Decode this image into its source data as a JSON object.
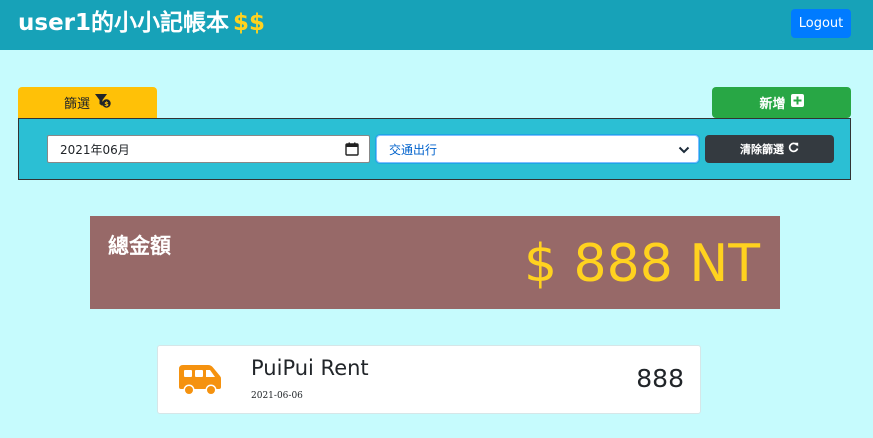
{
  "navbar": {
    "brand_text": "user1的小小記帳本",
    "brand_dollars": "$$",
    "logout_label": "Logout"
  },
  "filter": {
    "tab_label": "篩選",
    "icon": "filter-dollar-icon",
    "date_value": "2021年06月",
    "category_value": "交通出行",
    "clear_label": "清除篩選"
  },
  "add": {
    "label": "新增",
    "icon": "plus-square-icon"
  },
  "total": {
    "label": "總金額",
    "amount": "$ 888 NT"
  },
  "records": [
    {
      "icon": "shuttle-van-icon",
      "name": "PuiPui Rent",
      "date": "2021-06-06",
      "amount": "888"
    }
  ],
  "colors": {
    "background": "#c6fbfd",
    "navbar": "#17a2b8",
    "accent_yellow": "#ffd21f",
    "filter_tab": "#ffc107",
    "add_button": "#28a745",
    "filter_panel": "#2bbfd4",
    "total_box": "#976968",
    "icon_orange": "#f5920f"
  }
}
